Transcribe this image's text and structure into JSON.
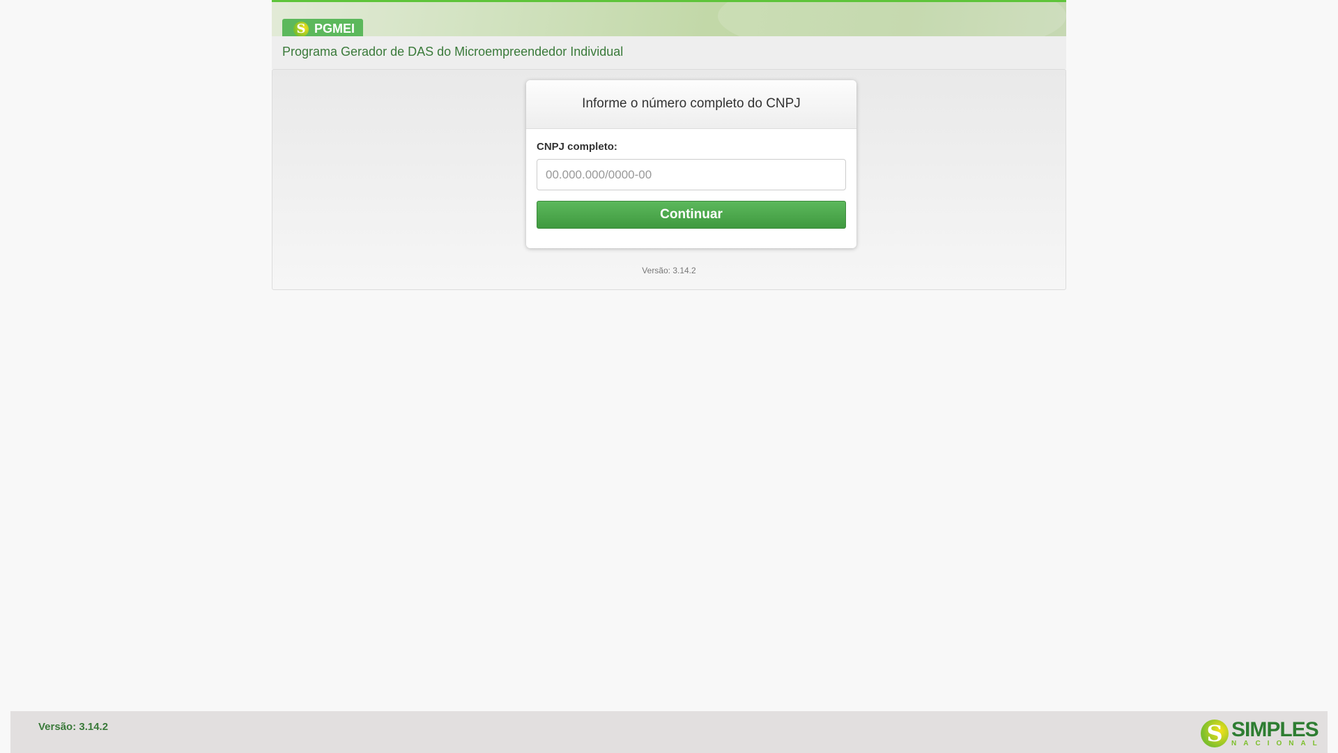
{
  "header": {
    "app_name": "PGMEI",
    "subtitle": "Programa Gerador de DAS do Microempreendedor Individual"
  },
  "card": {
    "title": "Informe o número completo do CNPJ",
    "cnpj_label": "CNPJ completo:",
    "cnpj_value": "",
    "cnpj_placeholder": "00.000.000/0000-00",
    "continue_label": "Continuar"
  },
  "panel_version": "Versão: 3.14.2",
  "footer": {
    "version": "Versão: 3.14.2",
    "logo_top": "SIMPLES",
    "logo_bottom": "NACIONAL"
  },
  "colors": {
    "accent": "#5cb85c",
    "title_green": "#3a7a3a"
  }
}
